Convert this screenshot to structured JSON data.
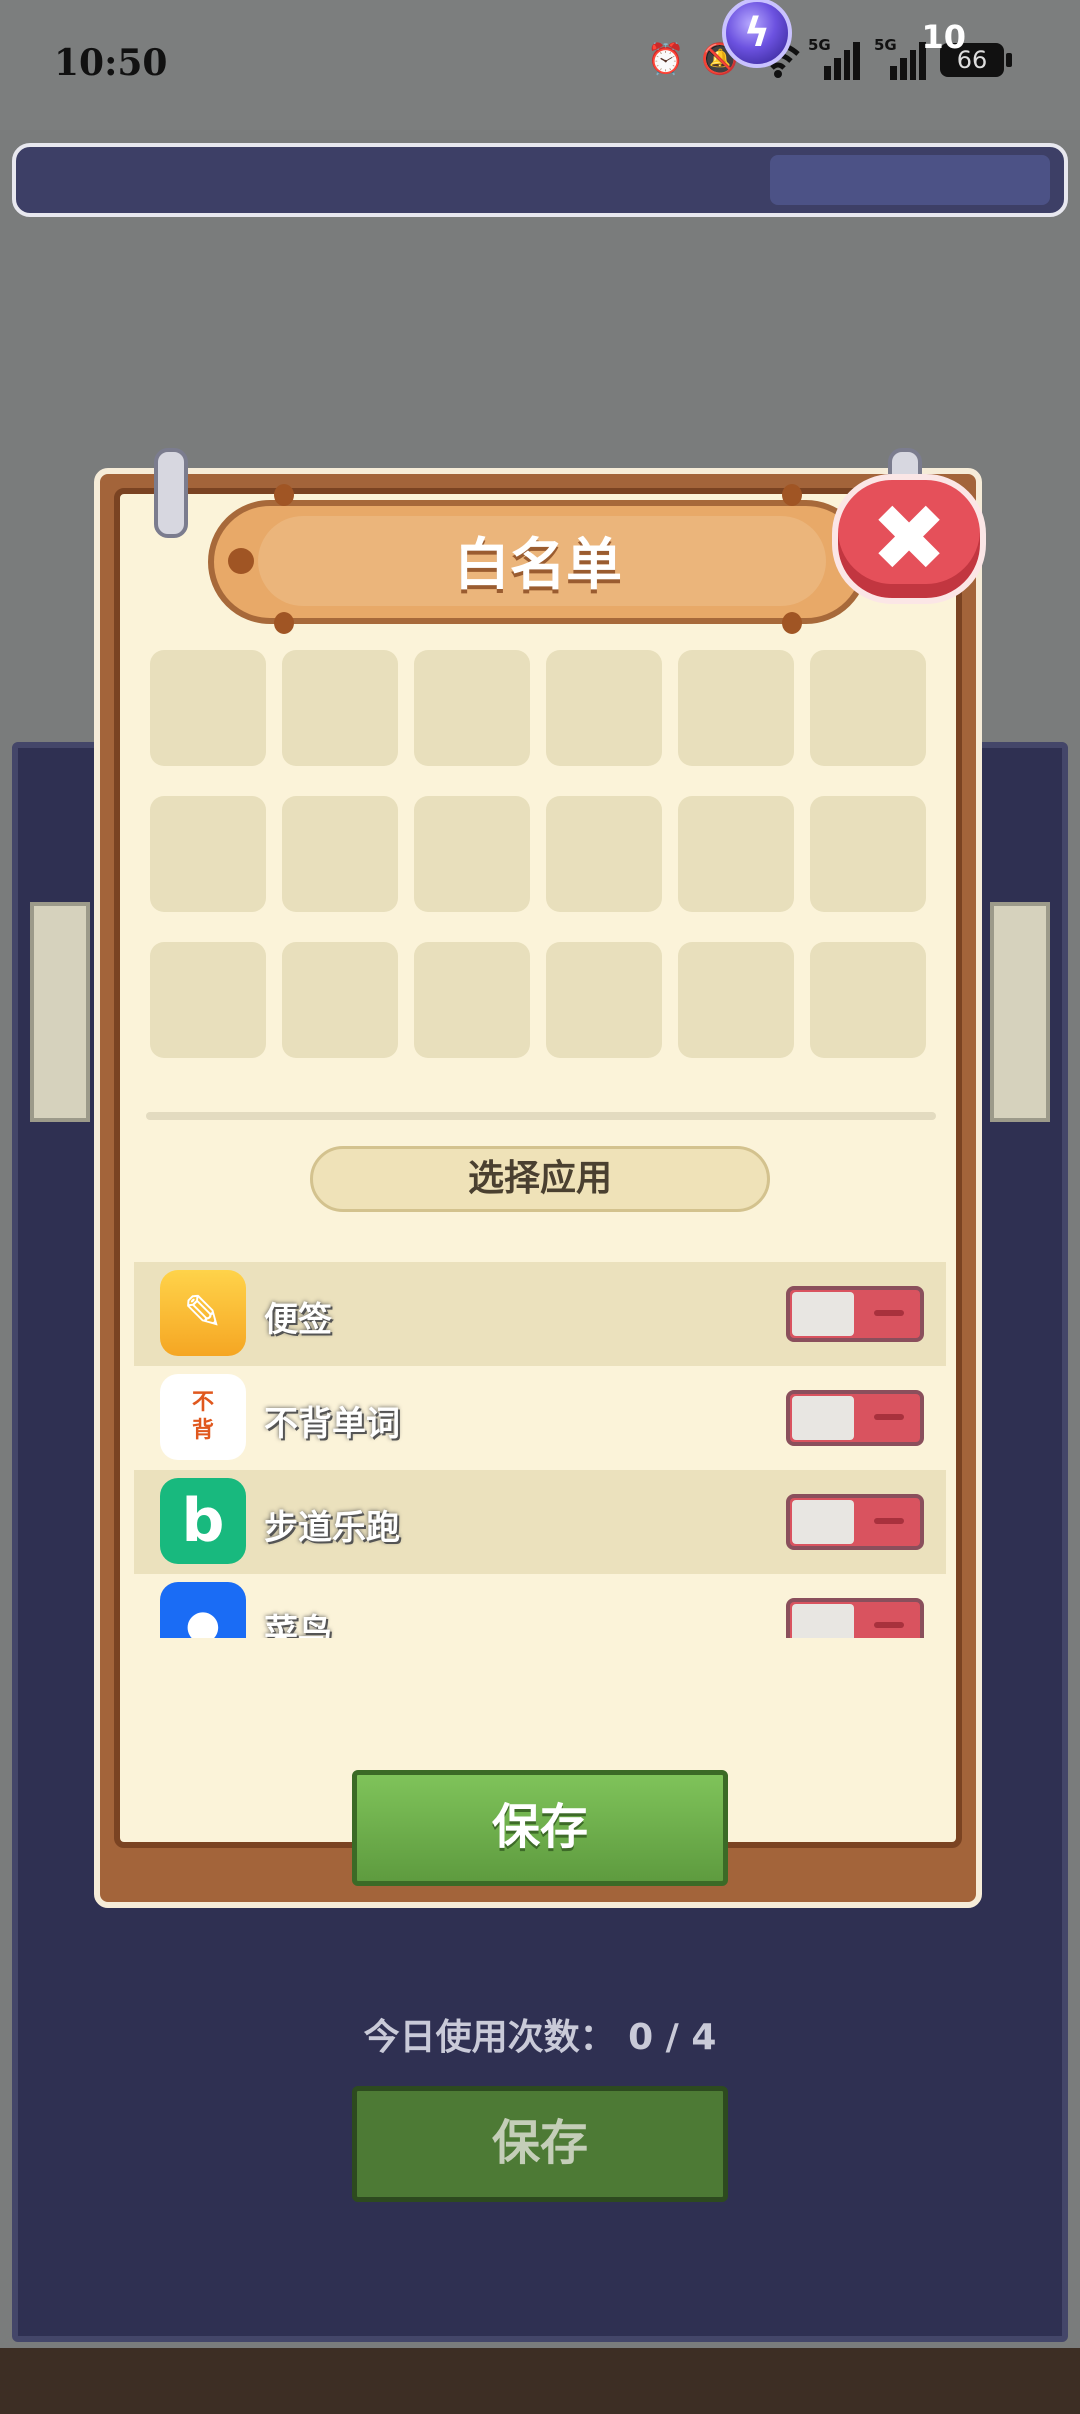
{
  "status_bar": {
    "time": "10:50",
    "network_label_1": "5G",
    "network_label_2": "5G",
    "battery": "66"
  },
  "energy": {
    "value": "10",
    "icon": "lightning-orb-icon"
  },
  "modal": {
    "title": "白名单",
    "close_icon": "close-icon",
    "select_apps_label": "选择应用",
    "apps": [
      {
        "name": "便签",
        "icon": "notes-app-icon",
        "enabled": false
      },
      {
        "name": "不背单词",
        "icon": "bubei-app-icon",
        "icon_text_top": "不",
        "icon_text_bottom": "背",
        "enabled": false
      },
      {
        "name": "步道乐跑",
        "icon": "budao-app-icon",
        "icon_text": "b",
        "enabled": false
      },
      {
        "name": "菜鸟",
        "icon": "cainiao-app-icon",
        "enabled": false
      }
    ],
    "save_label": "保存"
  },
  "background": {
    "usage_text": "今日使用次数： 0 / 4",
    "save_label": "保存"
  },
  "colors": {
    "frame": "#a3643a",
    "paper": "#fbf3d9",
    "close_red": "#e5505a",
    "save_green": "#6aad48",
    "bg_panel": "#2f3052"
  }
}
